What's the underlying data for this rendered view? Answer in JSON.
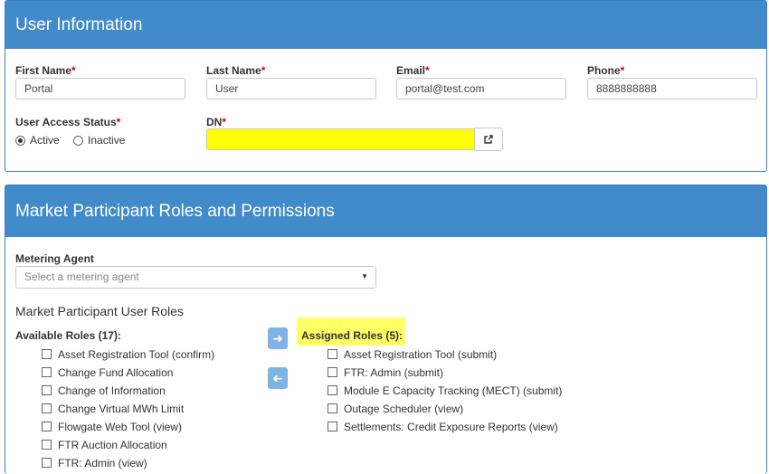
{
  "user_info": {
    "title": "User Information",
    "first_name": {
      "label": "First Name",
      "value": "Portal"
    },
    "last_name": {
      "label": "Last Name",
      "value": "User"
    },
    "email": {
      "label": "Email",
      "value": "portal@test.com"
    },
    "phone": {
      "label": "Phone",
      "value": "8888888888"
    },
    "access_status": {
      "label": "User Access Status",
      "options": [
        "Active",
        "Inactive"
      ],
      "selected": "Active"
    },
    "dn": {
      "label": "DN",
      "value": ""
    },
    "required_mark": "*",
    "highlight_color": "#ffff00"
  },
  "roles": {
    "title": "Market Participant Roles and Permissions",
    "metering_agent": {
      "label": "Metering Agent",
      "placeholder": "Select a metering agent"
    },
    "section_title": "Market Participant User Roles",
    "available_label": "Available Roles (17):",
    "assigned_label": "Assigned Roles (5):",
    "available": [
      "Asset Registration Tool (confirm)",
      "Change Fund Allocation",
      "Change of Information",
      "Change Virtual MWh Limit",
      "Flowgate Web Tool (view)",
      "FTR Auction Allocation",
      "FTR: Admin (view)"
    ],
    "assigned": [
      "Asset Registration Tool (submit)",
      "FTR: Admin (submit)",
      "Module E Capacity Tracking (MECT) (submit)",
      "Outage Scheduler (view)",
      "Settlements: Credit Exposure Reports (view)"
    ],
    "move_right_icon": "arrow-right-icon",
    "move_left_icon": "arrow-left-icon"
  }
}
